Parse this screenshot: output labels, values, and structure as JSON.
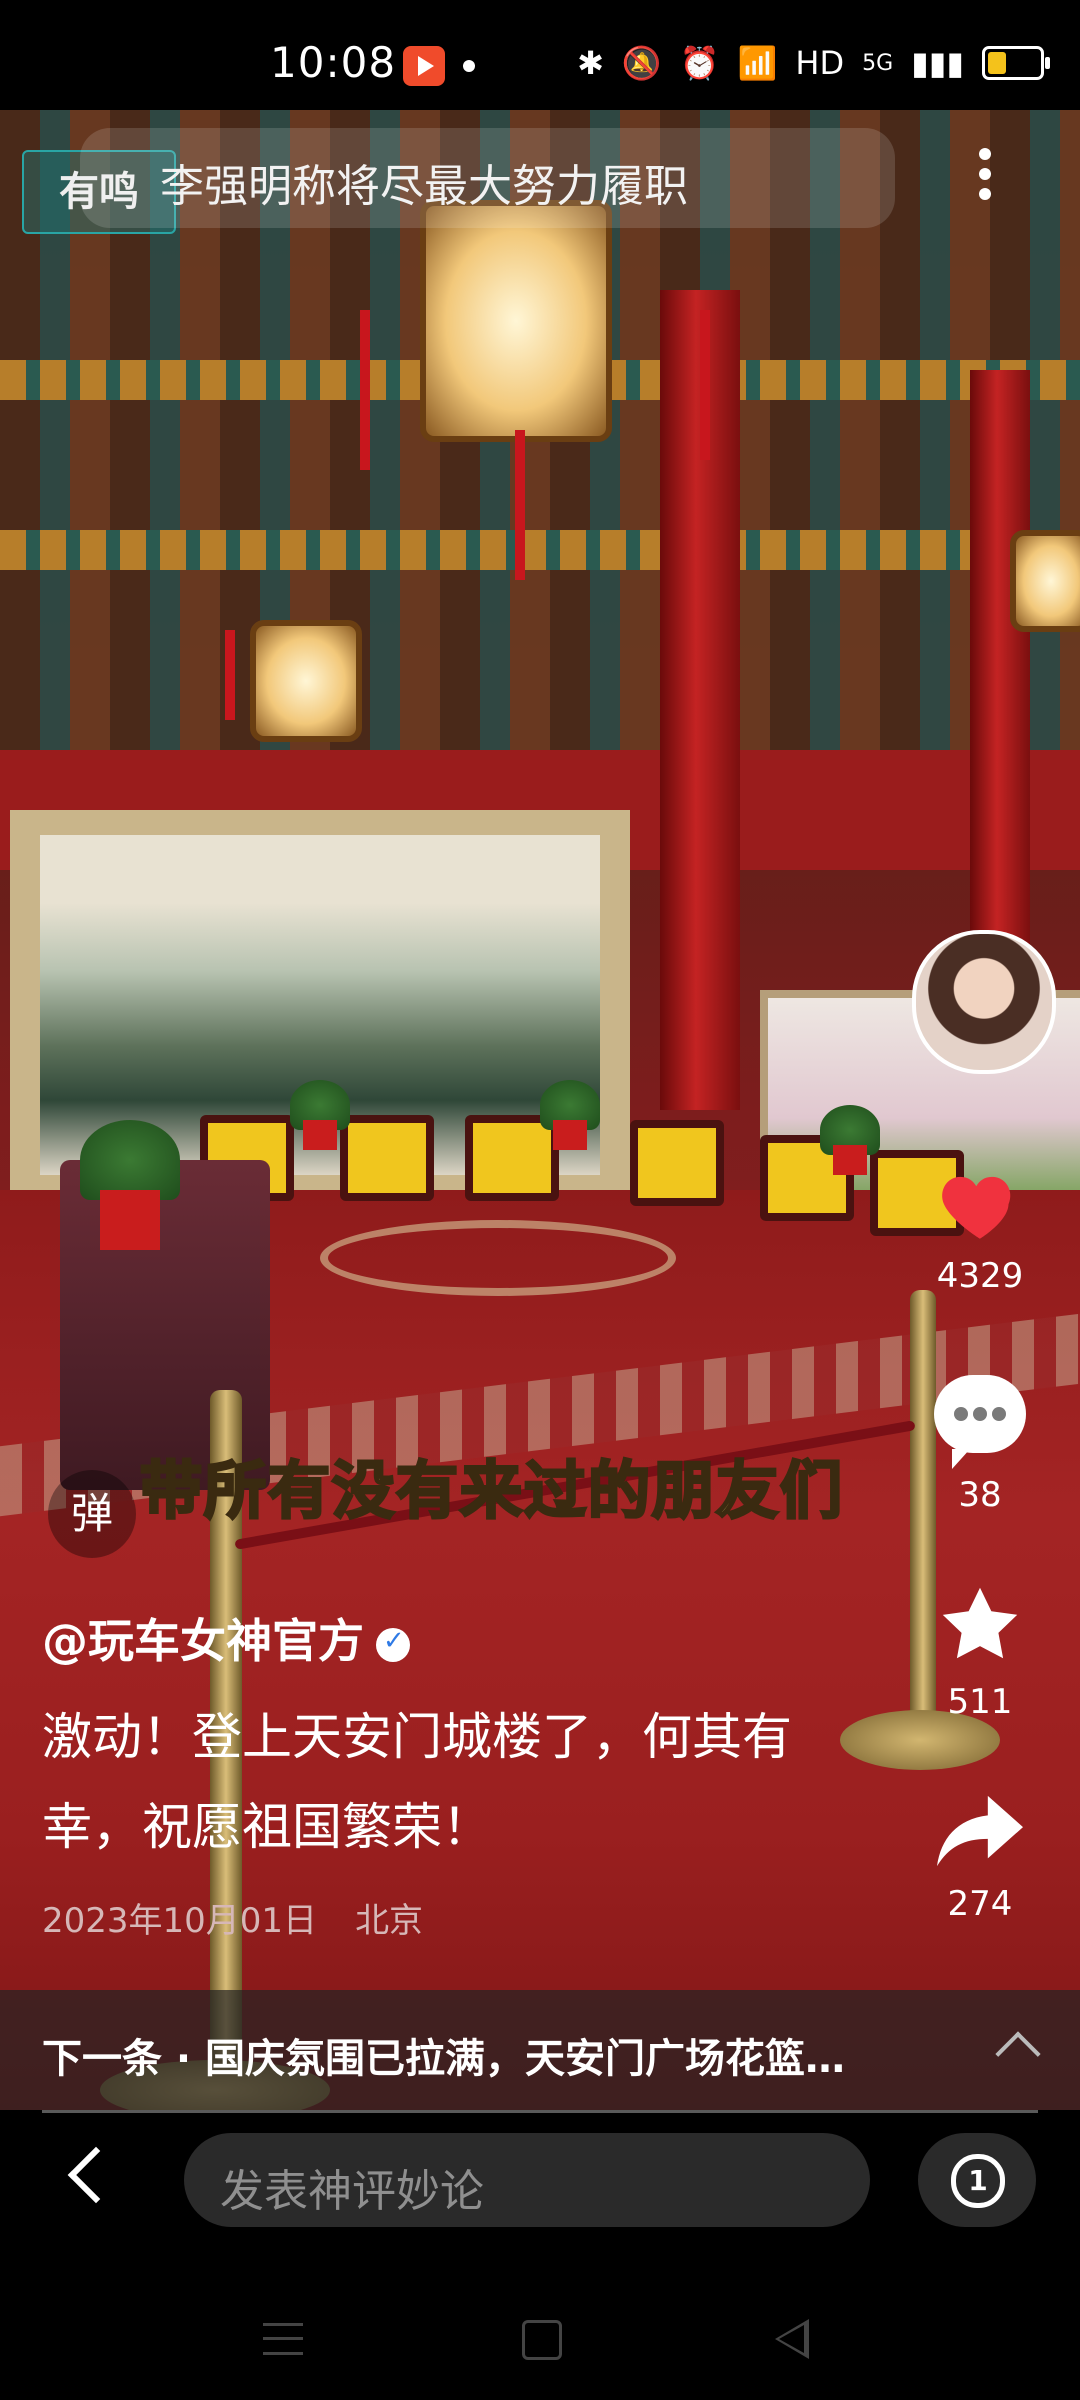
{
  "status_bar": {
    "time": "10:08",
    "network_label": "HD",
    "signal_label": "5G",
    "icons": [
      "bluetooth-icon",
      "mute-icon",
      "alarm-icon",
      "wifi-icon",
      "signal-icon",
      "battery-icon"
    ],
    "battery_color": "#f4c21b"
  },
  "video": {
    "watermark_text": "有鸣",
    "headline": "李强明称将尽最大努力履职",
    "caption": "带所有没有来过的朋友们",
    "danmu_label": "弹"
  },
  "actions": {
    "like_count": "4329",
    "comment_count": "38",
    "favorite_count": "511",
    "share_count": "274",
    "like_color": "#f0323e"
  },
  "post": {
    "author": "@玩车女神官方",
    "description": "激动！登上天安门城楼了，何其有幸，祝愿祖国繁荣！",
    "date": "2023年10月01日",
    "location": "北京"
  },
  "next": {
    "text": "下一条 · 国庆氛围已拉满，天安门广场花篮…"
  },
  "bottom_bar": {
    "comment_placeholder": "发表神评妙论",
    "reply_badge": "1"
  }
}
